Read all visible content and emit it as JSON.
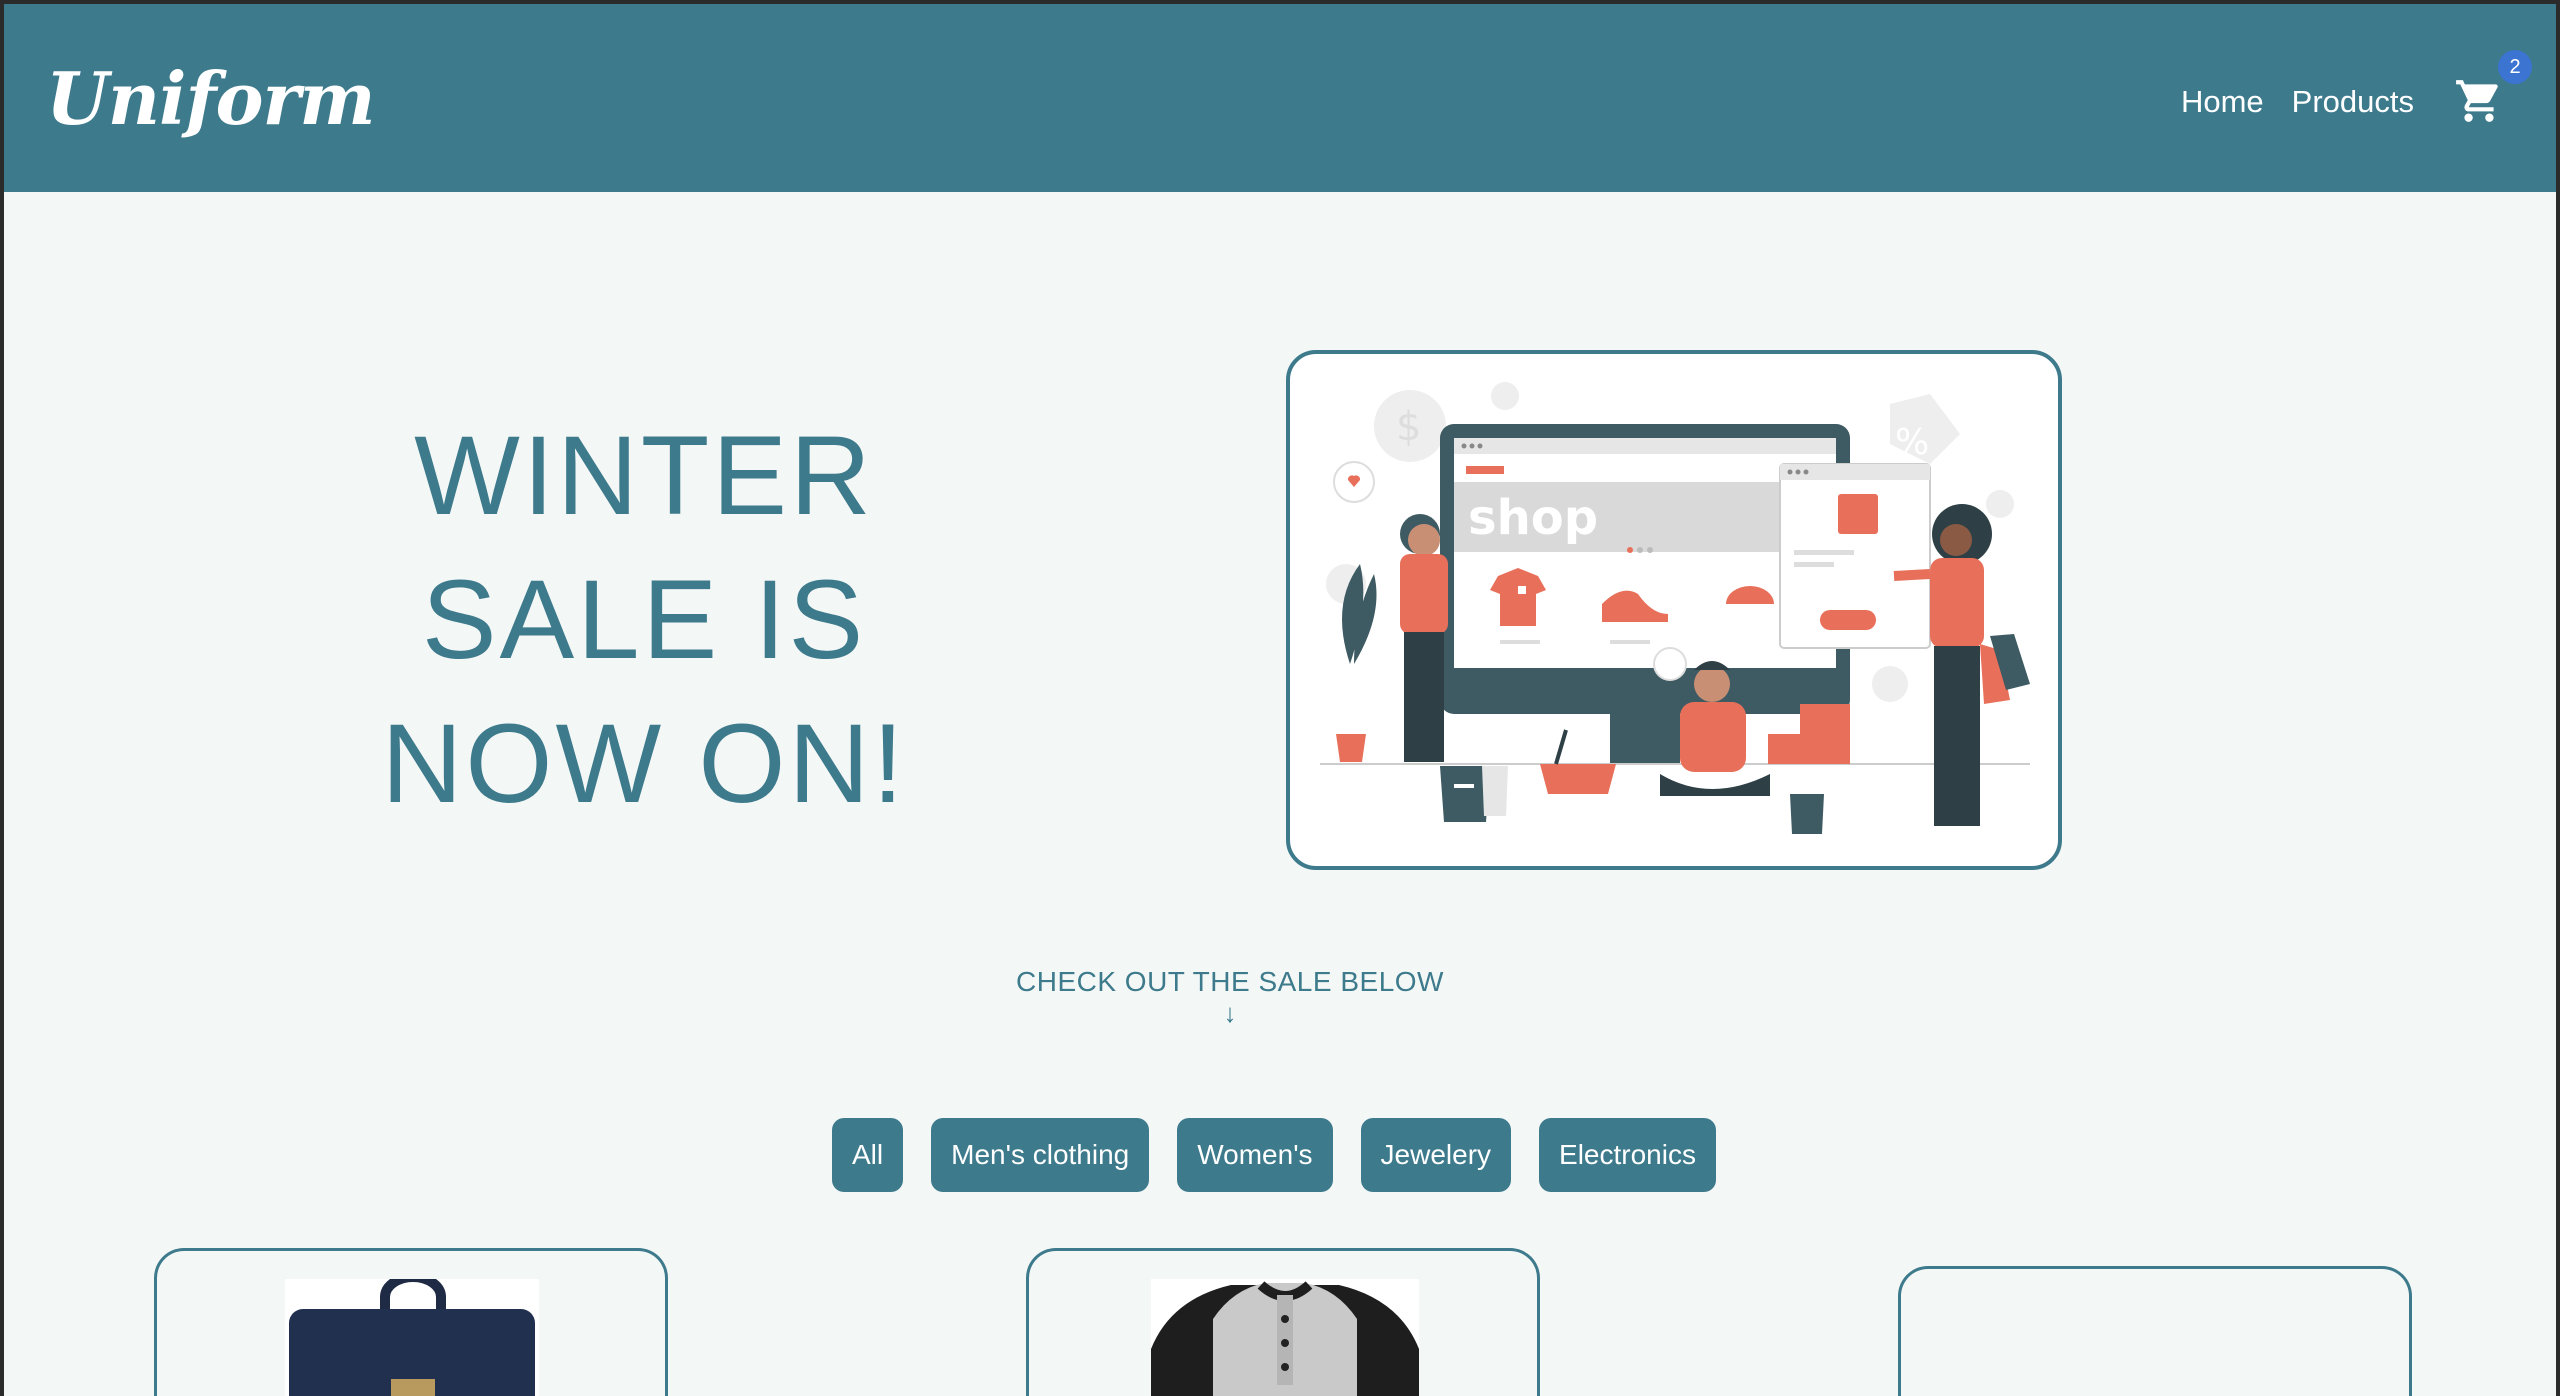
{
  "header": {
    "logo": "Uniform",
    "nav": [
      {
        "label": "Home"
      },
      {
        "label": "Products"
      }
    ],
    "cart_count": "2"
  },
  "hero": {
    "title_lines": [
      "WINTER",
      "SALE IS",
      "NOW ON!"
    ],
    "illustration_text": "shop"
  },
  "cta": {
    "label": "CHECK OUT THE SALE BELOW",
    "arrow": "↓"
  },
  "filters": [
    {
      "label": "All"
    },
    {
      "label": "Men's clothing"
    },
    {
      "label": "Women's"
    },
    {
      "label": "Jewelery"
    },
    {
      "label": "Electronics"
    }
  ],
  "products": [
    {
      "image": "backpack"
    },
    {
      "image": "henley-shirt"
    },
    {
      "image": ""
    }
  ],
  "colors": {
    "primary": "#3d7a8c",
    "background": "#f3f7f6",
    "accent": "#e8705a",
    "badge": "#3b74d1"
  }
}
